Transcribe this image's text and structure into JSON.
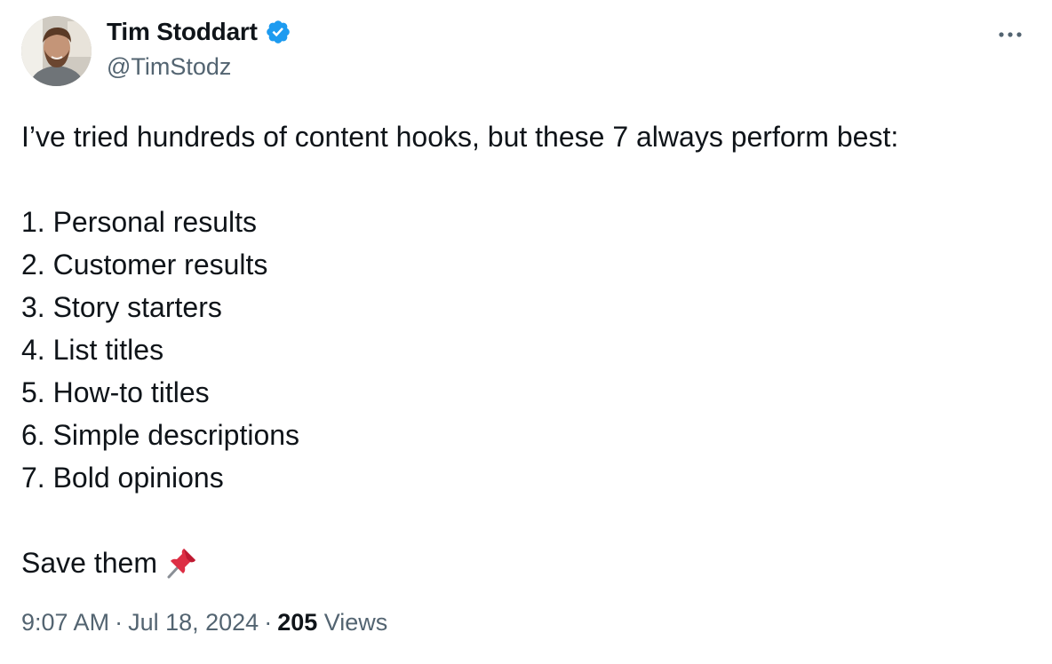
{
  "author": {
    "name": "Tim Stoddart",
    "handle": "@TimStodz",
    "verified": true,
    "verified_color": "#1d9bf0"
  },
  "tweet": {
    "intro": "I’ve tried hundreds of content hooks, but these 7 always perform best:",
    "items": [
      "1. Personal results",
      "2. Customer results",
      "3. Story starters",
      "4. List titles",
      "5. How-to titles",
      "6. Simple descriptions",
      "7. Bold opinions"
    ],
    "outro": "Save them",
    "outro_emoji": "pushpin-icon"
  },
  "meta": {
    "time": "9:07 AM",
    "separator": "·",
    "date": "Jul 18, 2024",
    "views_count": "205",
    "views_label": "Views"
  },
  "icons": {
    "more": "more-options-icon",
    "verified": "verified-badge-icon"
  },
  "colors": {
    "text_primary": "#0f1419",
    "text_secondary": "#536471",
    "accent": "#1d9bf0"
  }
}
